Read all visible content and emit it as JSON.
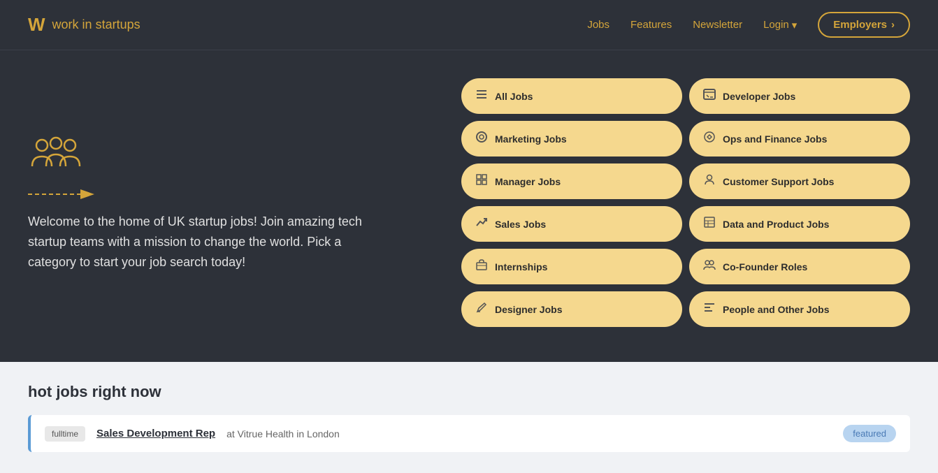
{
  "header": {
    "logo_icon": "W",
    "logo_text": "work in startups",
    "nav": {
      "jobs_label": "Jobs",
      "features_label": "Features",
      "newsletter_label": "Newsletter",
      "login_label": "Login",
      "employers_label": "Employers"
    }
  },
  "hero": {
    "tagline": "Welcome to the home of UK startup jobs! Join amazing tech startup teams with a mission to change the world. Pick a category to start your job search today!",
    "job_categories": [
      {
        "id": "all-jobs",
        "label": "All Jobs",
        "icon": "☰"
      },
      {
        "id": "developer-jobs",
        "label": "Developer Jobs",
        "icon": "⌨"
      },
      {
        "id": "marketing-jobs",
        "label": "Marketing Jobs",
        "icon": "◎"
      },
      {
        "id": "ops-finance-jobs",
        "label": "Ops and Finance Jobs",
        "icon": "⚙"
      },
      {
        "id": "manager-jobs",
        "label": "Manager Jobs",
        "icon": "▦"
      },
      {
        "id": "customer-support-jobs",
        "label": "Customer Support Jobs",
        "icon": "👤"
      },
      {
        "id": "sales-jobs",
        "label": "Sales Jobs",
        "icon": "↗"
      },
      {
        "id": "data-product-jobs",
        "label": "Data and Product Jobs",
        "icon": "▤"
      },
      {
        "id": "internships",
        "label": "Internships",
        "icon": "🏢"
      },
      {
        "id": "co-founder-roles",
        "label": "Co-Founder Roles",
        "icon": "👥"
      },
      {
        "id": "designer-jobs",
        "label": "Designer Jobs",
        "icon": "✏"
      },
      {
        "id": "people-other-jobs",
        "label": "People and Other Jobs",
        "icon": "☰"
      }
    ]
  },
  "hot_jobs": {
    "section_title": "hot jobs right now",
    "listings": [
      {
        "type": "fulltime",
        "title": "Sales Development Rep",
        "company": "Vitrue Health",
        "location": "London",
        "featured": true,
        "featured_label": "featured"
      }
    ]
  }
}
